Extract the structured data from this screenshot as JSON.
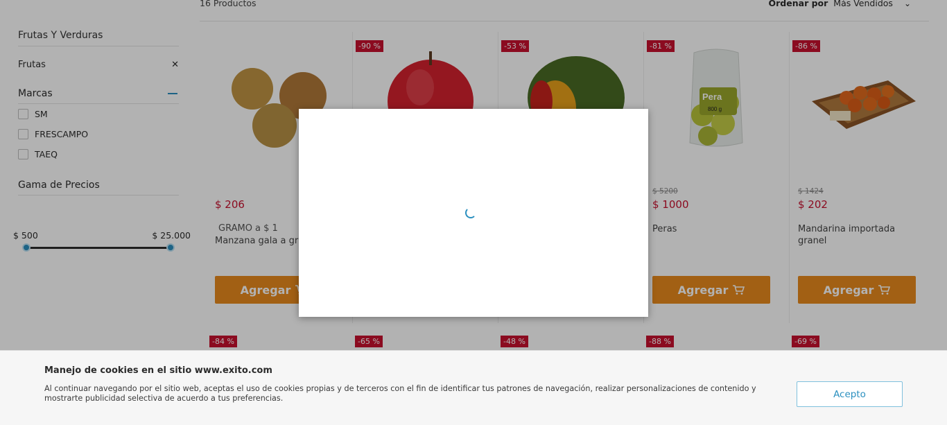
{
  "results": {
    "count_text": "16 Productos"
  },
  "sort": {
    "label": "Ordenar por",
    "value": "Más Vendidos"
  },
  "sidebar": {
    "category_title": "Frutas Y Verduras",
    "selected_filter": "Frutas",
    "brands_title": "Marcas",
    "brands": [
      "SM",
      "FRESCAMPO",
      "TAEQ"
    ],
    "price_title": "Gama de Precios",
    "price_min": "$ 500",
    "price_max": "$ 25.000"
  },
  "products": [
    {
      "badge": "",
      "old_price": "",
      "price": "$ 206",
      "unit": "GRAMO a $ 1",
      "name": "Manzana gala a gr"
    },
    {
      "badge": "-90 %",
      "old_price": "",
      "price": "",
      "unit": "",
      "name": ""
    },
    {
      "badge": "-53 %",
      "old_price": "",
      "price": "",
      "unit": "",
      "name": ""
    },
    {
      "badge": "-81 %",
      "old_price": "$ 5200",
      "price": "$ 1000",
      "unit": "",
      "name": "Peras"
    },
    {
      "badge": "-86 %",
      "old_price": "$ 1424",
      "price": "$ 202",
      "unit": "",
      "name": "Mandarina importada granel"
    }
  ],
  "row2_badges": [
    "-84 %",
    "-65 %",
    "-48 %",
    "-88 %",
    "-69 %"
  ],
  "add_button_label": "Agregar",
  "pear_package": {
    "brand": "Pera",
    "weight": "800 g"
  },
  "cookie": {
    "title": "Manejo de cookies en el sitio www.exito.com",
    "text": "Al continuar navegando por el sitio web, aceptas el uso de cookies propias y de terceros con el fin de identificar tus patrones de navegación, realizar personalizaciones de contenido y mostrarte publicidad selectiva de acuerdo a tus preferencias.",
    "accept_label": "Acepto"
  },
  "colors": {
    "accent_orange": "#e88a1e",
    "discount_red": "#c8102e",
    "brand_blue": "#2a8fbf"
  }
}
